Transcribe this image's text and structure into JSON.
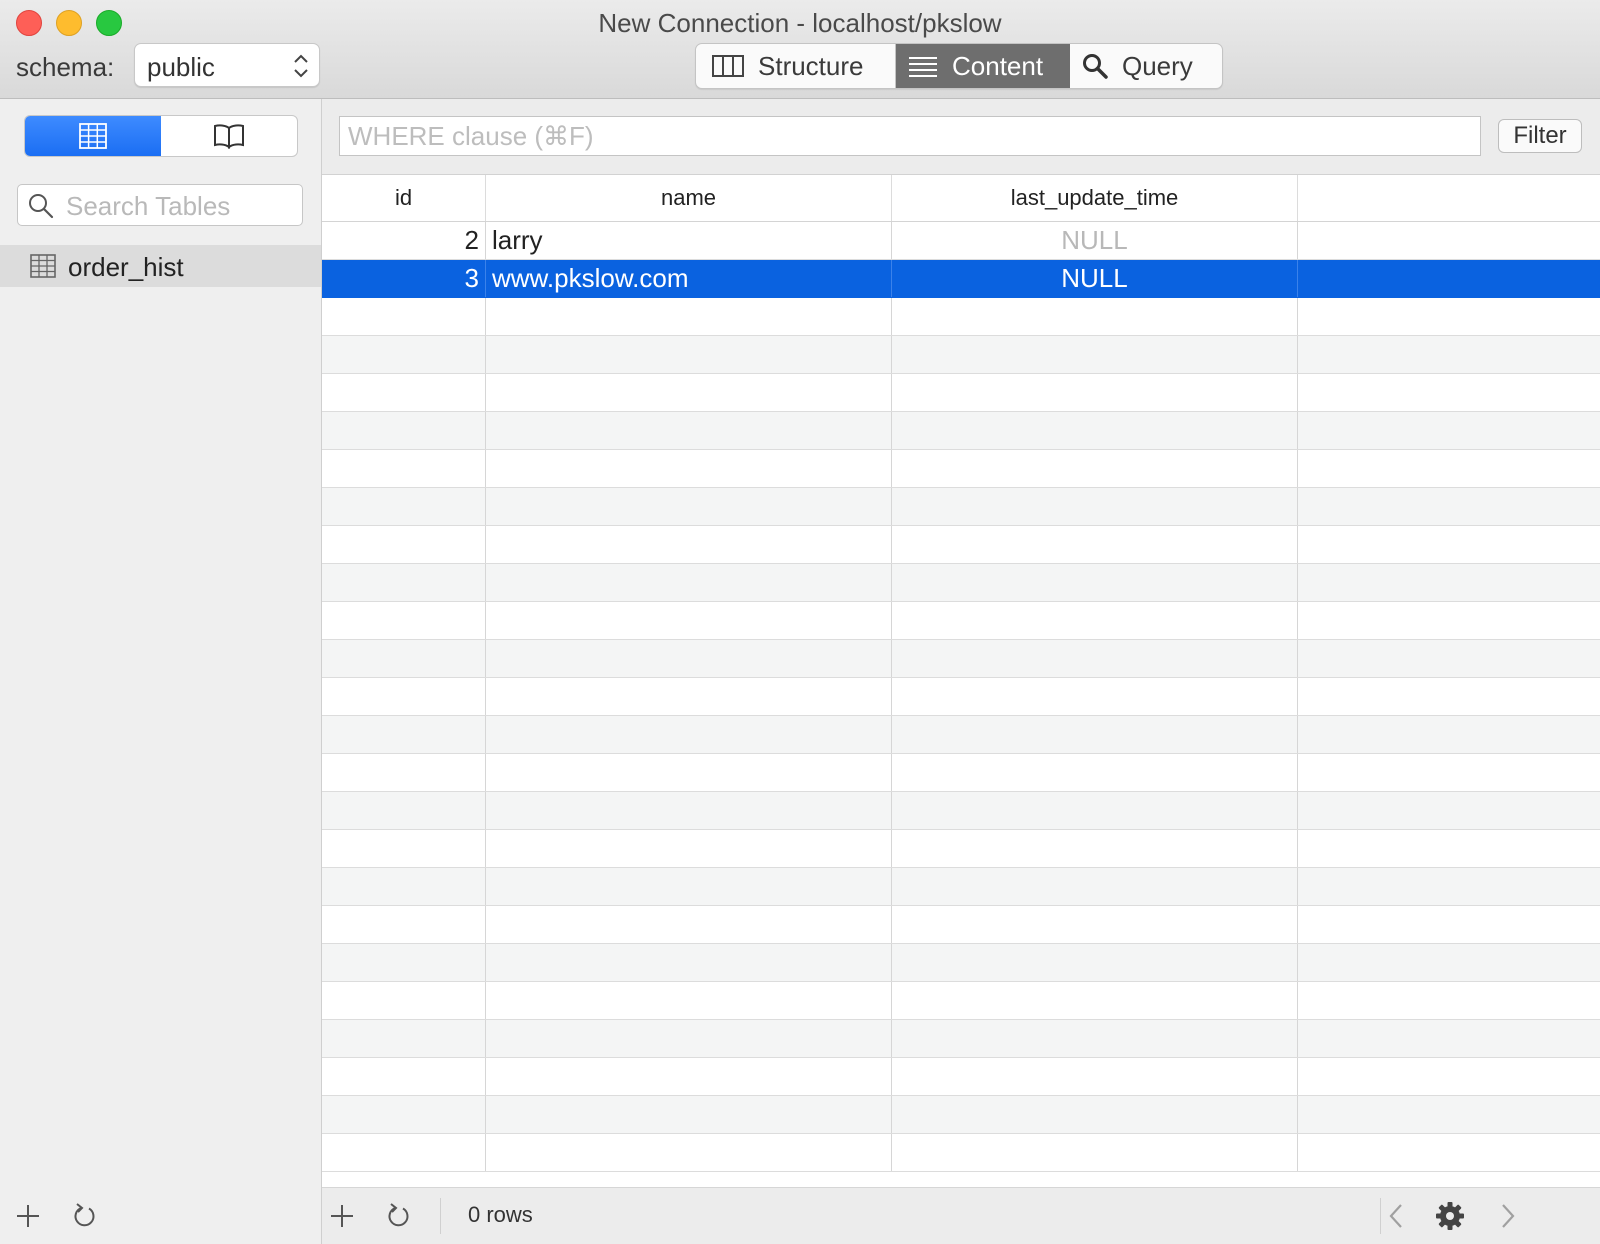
{
  "window": {
    "title": "New Connection - localhost/pkslow"
  },
  "toolbar": {
    "schema_label": "schema:",
    "schema_value": "public",
    "tabs": [
      {
        "label": "Structure",
        "icon": "columns-icon",
        "active": false
      },
      {
        "label": "Content",
        "icon": "list-icon",
        "active": true
      },
      {
        "label": "Query",
        "icon": "search-icon",
        "active": false
      }
    ]
  },
  "sidebar": {
    "view_toggle": [
      {
        "icon": "grid-icon",
        "active": true
      },
      {
        "icon": "book-icon",
        "active": false
      }
    ],
    "search_placeholder": "Search Tables",
    "tables": [
      {
        "label": "order_hist",
        "icon": "table-icon",
        "selected": true
      }
    ],
    "footer": {
      "add_icon": "plus-icon",
      "refresh_icon": "refresh-icon"
    }
  },
  "filter": {
    "placeholder": "WHERE clause (⌘F)",
    "button_label": "Filter"
  },
  "grid": {
    "columns": [
      "id",
      "name",
      "last_update_time"
    ],
    "rows": [
      {
        "id": "2",
        "name": "larry",
        "last_update_time": "NULL",
        "selected": false
      },
      {
        "id": "3",
        "name": "www.pkslow.com",
        "last_update_time": "NULL",
        "selected": true
      }
    ]
  },
  "footer": {
    "rows_label": "0 rows",
    "icons": [
      "plus-icon",
      "refresh-icon",
      "chevron-left-icon",
      "gear-icon",
      "chevron-right-icon"
    ]
  },
  "colors": {
    "selection": "#0a62e0",
    "toggle_active": "#1b6ef3",
    "active_tab": "#6e6e6e",
    "close": "#fe5f57",
    "minimize": "#febc2e",
    "zoom": "#28c840"
  }
}
